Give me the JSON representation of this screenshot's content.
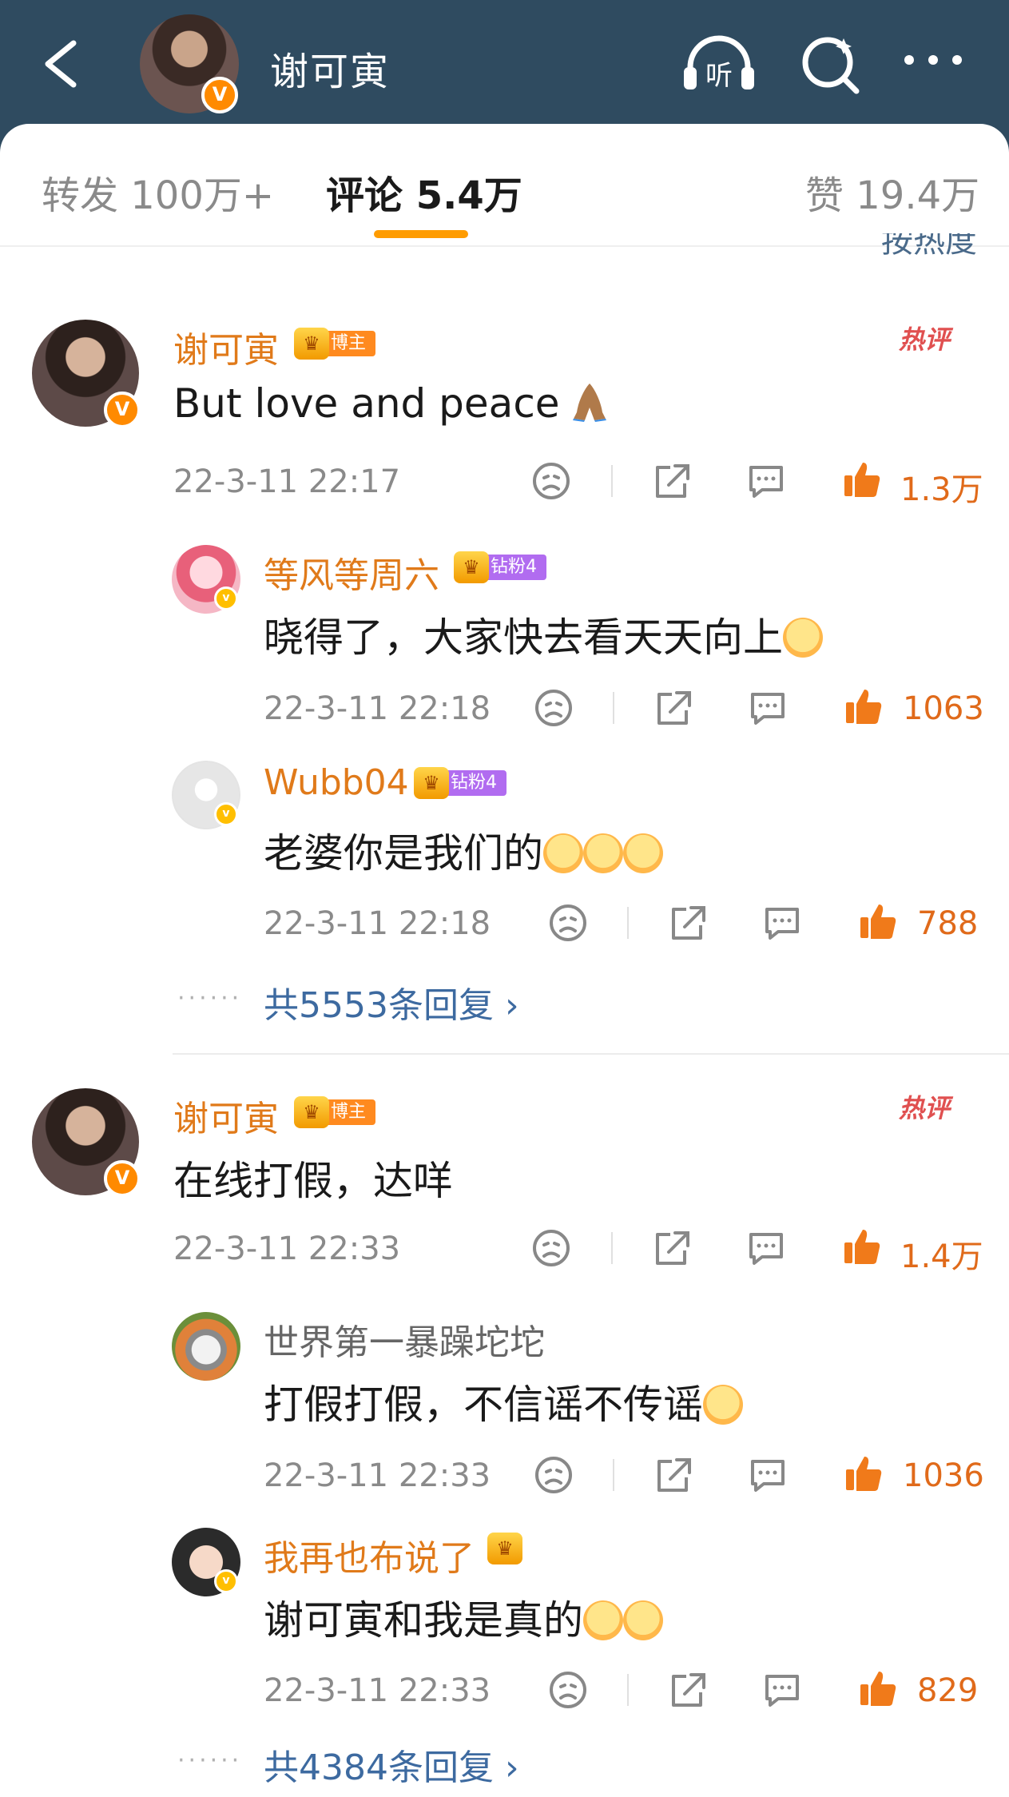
{
  "header": {
    "title": "谢可寅",
    "listen_label": "听"
  },
  "tabs": {
    "repost": "转发 100万+",
    "comments": "评论 5.4万",
    "likes": "赞 19.4万"
  },
  "sort_peek": "按热度",
  "comments": [
    {
      "user": "谢可寅",
      "badge": "博主",
      "hot_label": "热评",
      "text": "But love and peace ",
      "time": "22-3-11 22:17",
      "likes": "1.3万",
      "replies": [
        {
          "user": "等风等周六",
          "badge": "钻粉4",
          "text": "晓得了，大家快去看天天向上",
          "time": "22-3-11 22:18",
          "likes": "1063"
        },
        {
          "user": "Wubb04",
          "badge": "钻粉4",
          "text": "老婆你是我们的",
          "time": "22-3-11 22:18",
          "likes": "788"
        }
      ],
      "more_replies": "共5553条回复 ›"
    },
    {
      "user": "谢可寅",
      "badge": "博主",
      "hot_label": "热评",
      "text": "在线打假，达咩",
      "time": "22-3-11 22:33",
      "likes": "1.4万",
      "replies": [
        {
          "user": "世界第一暴躁坨坨",
          "text": "打假打假，不信谣不传谣",
          "time": "22-3-11 22:33",
          "likes": "1036"
        },
        {
          "user": "我再也布说了",
          "text": "谢可寅和我是真的",
          "time": "22-3-11 22:33",
          "likes": "829"
        }
      ],
      "more_replies": "共4384条回复 ›"
    }
  ],
  "colors": {
    "header_bg": "#2f4b60",
    "accent_orange": "#ff9c00",
    "username": "#e07a1a",
    "link_blue": "#3d6aa0"
  }
}
